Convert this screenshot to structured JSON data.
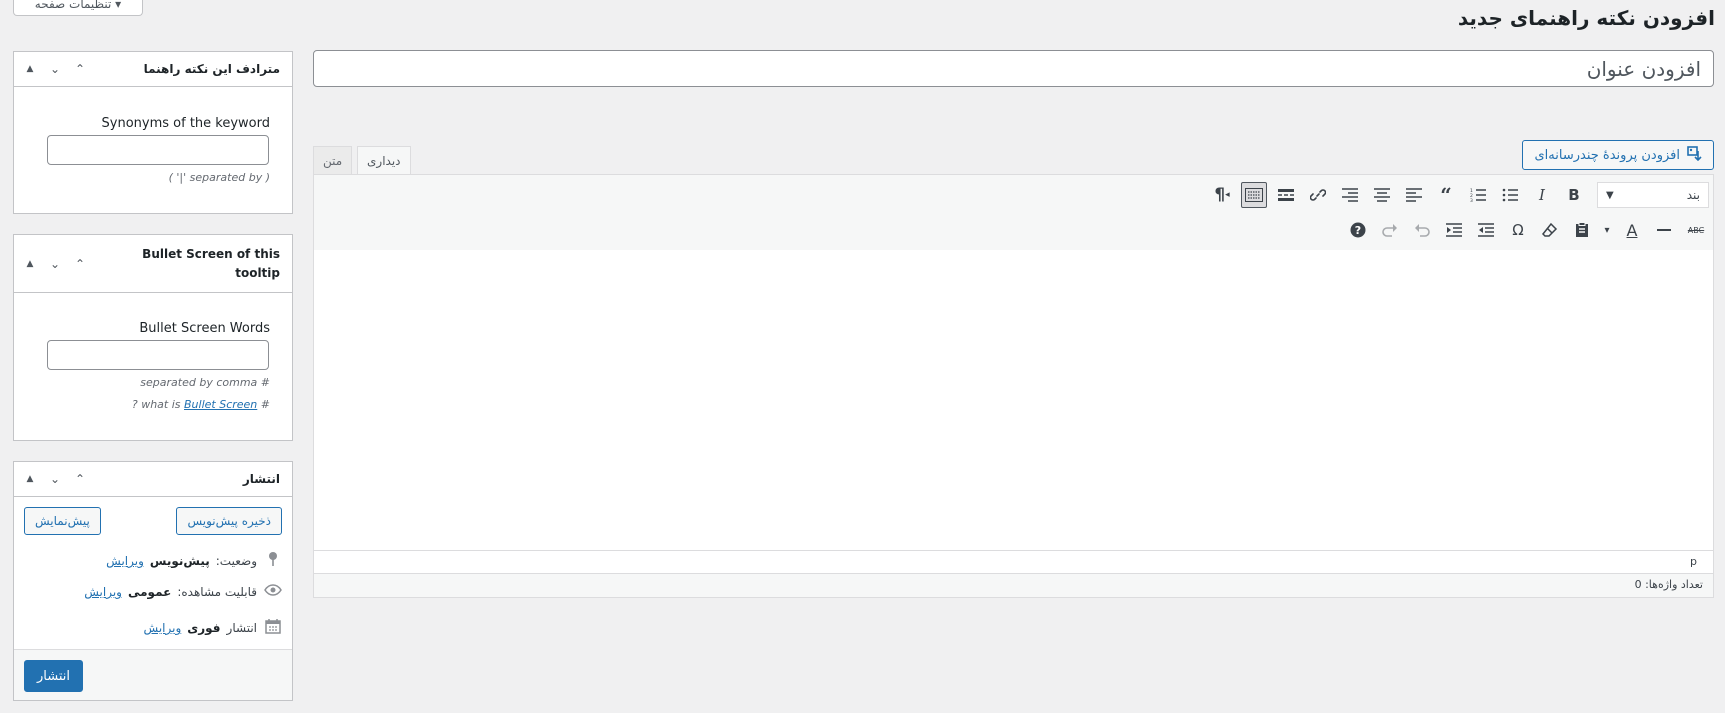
{
  "header": {
    "screen_options_label": "تنظیمات صفحه ▾",
    "page_title": "افزودن نکته راهنمای جدید"
  },
  "title_field": {
    "placeholder": "افزودن عنوان",
    "value": ""
  },
  "media_button": {
    "label": "افزودن پروندهٔ چندرسانه‌ای"
  },
  "editor": {
    "tabs": [
      {
        "label": "دیداری",
        "active": true
      },
      {
        "label": "متن",
        "active": false
      }
    ],
    "format_select": {
      "value": "بند"
    },
    "toolbar_row1": [
      {
        "name": "bold",
        "glyph": "B"
      },
      {
        "name": "italic",
        "glyph": "I"
      },
      {
        "name": "bullet-list",
        "glyph": "☰"
      },
      {
        "name": "numbered-list",
        "glyph": "☷"
      },
      {
        "name": "blockquote",
        "glyph": "❝"
      },
      {
        "name": "align-left",
        "glyph": "≡"
      },
      {
        "name": "align-center",
        "glyph": "≡"
      },
      {
        "name": "align-right",
        "glyph": "≡"
      },
      {
        "name": "link",
        "glyph": "🔗"
      },
      {
        "name": "read-more",
        "glyph": "▬"
      },
      {
        "name": "toolbar-toggle",
        "glyph": "⌨"
      },
      {
        "name": "rtl-direction",
        "glyph": "¶◂"
      }
    ],
    "toolbar_row2": [
      {
        "name": "strikethrough",
        "glyph": "ABC"
      },
      {
        "name": "horizontal-line",
        "glyph": "—"
      },
      {
        "name": "text-color",
        "glyph": "A"
      },
      {
        "name": "text-color-dropdown",
        "glyph": "▾"
      },
      {
        "name": "paste-as-text",
        "glyph": "📋"
      },
      {
        "name": "clear-formatting",
        "glyph": "⌫"
      },
      {
        "name": "special-character",
        "glyph": "Ω"
      },
      {
        "name": "outdent",
        "glyph": "⇤"
      },
      {
        "name": "indent",
        "glyph": "⇥"
      },
      {
        "name": "undo",
        "glyph": "↶"
      },
      {
        "name": "redo",
        "glyph": "↷"
      },
      {
        "name": "help",
        "glyph": "?"
      }
    ],
    "path": "p",
    "word_count": "تعداد واژه‌ها: 0"
  },
  "synonyms_box": {
    "title": "مترادف این نکته راهنما",
    "label": "Synonyms of the keyword",
    "hint": "( '|' separated by )",
    "value": ""
  },
  "bullet_box": {
    "title": "Bullet Screen of this tooltip",
    "label": "Bullet Screen Words",
    "hint1": "separated by comma #",
    "hint2_prefix": "? what is ",
    "hint2_link": "Bullet Screen",
    "hint2_suffix": " #",
    "value": ""
  },
  "publish_box": {
    "title": "انتشار",
    "save_draft_label": "ذخیره پیش‌نویس",
    "preview_label": "پیش‌نمایش",
    "status_label": "وضعیت:",
    "status_value": "پیش‌نویس",
    "visibility_label": "قابلیت مشاهده:",
    "visibility_value": "عمومی",
    "schedule_label": "انتشار",
    "schedule_value": "فوری",
    "edit_link": "ویرایش",
    "publish_label": "انتشار"
  },
  "box_controls": {
    "up": "⌃",
    "down": "⌄",
    "toggle": "▴"
  },
  "colors": {
    "accent": "#2271b1",
    "background": "#f0f0f1"
  }
}
